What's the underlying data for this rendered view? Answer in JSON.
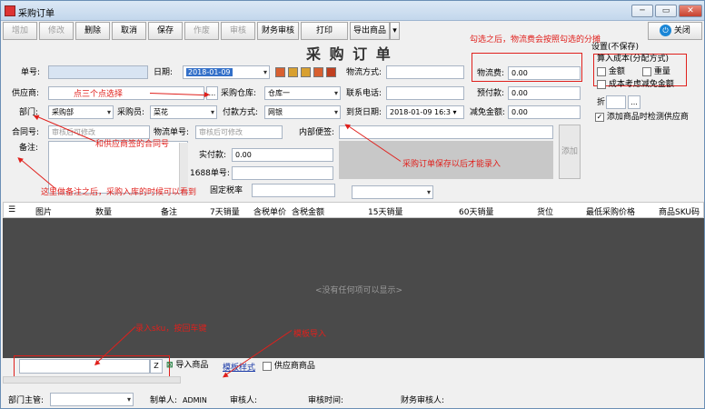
{
  "window": {
    "title": "采购订单",
    "close_label": "关闭",
    "minimize": "─",
    "restore": "▭",
    "exit": "✕",
    "power": "⏻"
  },
  "toolbar": {
    "add": "增加",
    "edit": "修改",
    "delete": "删除",
    "cancel": "取消",
    "save": "保存",
    "void": "作废",
    "audit": "审核",
    "finance_audit": "财务审核",
    "print": "打印",
    "export": "导出商品",
    "export_arrow": "▾"
  },
  "form": {
    "title": "采 购 订 单",
    "order_no_label": "单号:",
    "order_no_value": "",
    "date_label": "日期:",
    "date_value": "2018-01-09",
    "logistics_label": "物流方式:",
    "logistics_value": "",
    "supplier_label": "供应商:",
    "supplier_value": "",
    "ellipsis": "...",
    "warehouse_label": "采购仓库:",
    "warehouse_value": "仓库一",
    "phone_label": "联系电话:",
    "phone_value": "",
    "prepaid_label": "预付款:",
    "prepaid_value": "0.00",
    "freight_label": "物流费:",
    "freight_value": "0.00",
    "dept_label": "部门:",
    "dept_value": "采购部",
    "buyer_label": "采购员:",
    "buyer_value": "菜花",
    "pay_label": "付款方式:",
    "pay_value": "网银",
    "arrival_label": "到货日期:",
    "arrival_value": "2018-01-09 16:3 ▾",
    "discount_label": "减免金额:",
    "discount_value": "0.00",
    "contract_label": "合同号:",
    "contract_value": "审核后可修改",
    "logistics_no_label": "物流单号:",
    "logistics_no_value": "审核后可修改",
    "memo_inner_label": "内部便签:",
    "memo_inner_value": "",
    "remark_label": "备注:",
    "remark_value": "",
    "paid_label": "实付款:",
    "paid_value": "0.00",
    "no1688_label": "1688单号:",
    "no1688_value": "",
    "rate_label": "固定税率",
    "rate_value": "",
    "add_btn": "添加",
    "bottom_select": ""
  },
  "settings": {
    "title": "设置(不保存)",
    "group": "算入成本(分配方式)",
    "amount": "金额",
    "weight": "重量",
    "cost_exempt": "成本考虑减免金额",
    "discount_label": "折",
    "check_supplier": "添加商品时检测供应商",
    "ellipsis": "..."
  },
  "table": {
    "headers": [
      "图片",
      "数量",
      "备注",
      "7天销量",
      "含税单价",
      "含税金额",
      "15天销量",
      "60天销量",
      "货位",
      "最低采购价格",
      "商品SKU码"
    ],
    "empty_text": "<没有任何项可以显示>"
  },
  "bottombar": {
    "sku_input": "",
    "z_btn": "Z",
    "import_btn": "导入商品",
    "template_link": "模板样式",
    "supplier_goods": "供应商商品"
  },
  "footer": {
    "dept_head_label": "部门主管:",
    "dept_head_value": "",
    "maker_label": "制单人:",
    "maker_value": "ADMIN",
    "auditor_label": "审核人:",
    "audit_time_label": "审核时间:",
    "fin_auditor_label": "财务审核人:"
  },
  "annotations": {
    "a1": "勾选之后，物流费会按照勾选的分摊",
    "a2": "点三个点选择",
    "a3": "和供应商签的合同号",
    "a4": "这里做备注之后，采购入库的时候可以看到",
    "a5": "采购订单保存以后才能录入",
    "a6": "录入sku，按回车键",
    "a7": "模板导入"
  },
  "colors": {
    "accent": "#e0201c",
    "grid": "#4a4a4a"
  }
}
